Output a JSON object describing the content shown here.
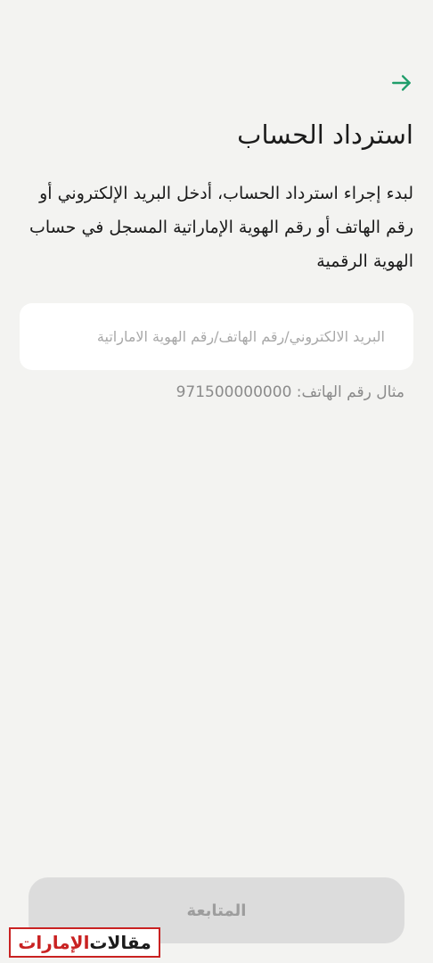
{
  "header": {
    "back_icon": "arrow-right-icon",
    "accent_color": "#1f9d6a"
  },
  "page": {
    "title": "استرداد الحساب",
    "description": "لبدء إجراء استرداد الحساب، أدخل البريد الإلكتروني أو رقم الهاتف أو رقم الهوية الإماراتية المسجل في حساب الهوية الرقمية"
  },
  "form": {
    "identifier_value": "",
    "identifier_placeholder": "البريد الالكتروني/رقم الهاتف/رقم الهوية الاماراتية",
    "hint": "مثال رقم الهاتف: 971500000000"
  },
  "footer": {
    "continue_label": "المتابعة"
  },
  "watermark": {
    "part1": "مقالات",
    "part2": "الإمارات"
  }
}
